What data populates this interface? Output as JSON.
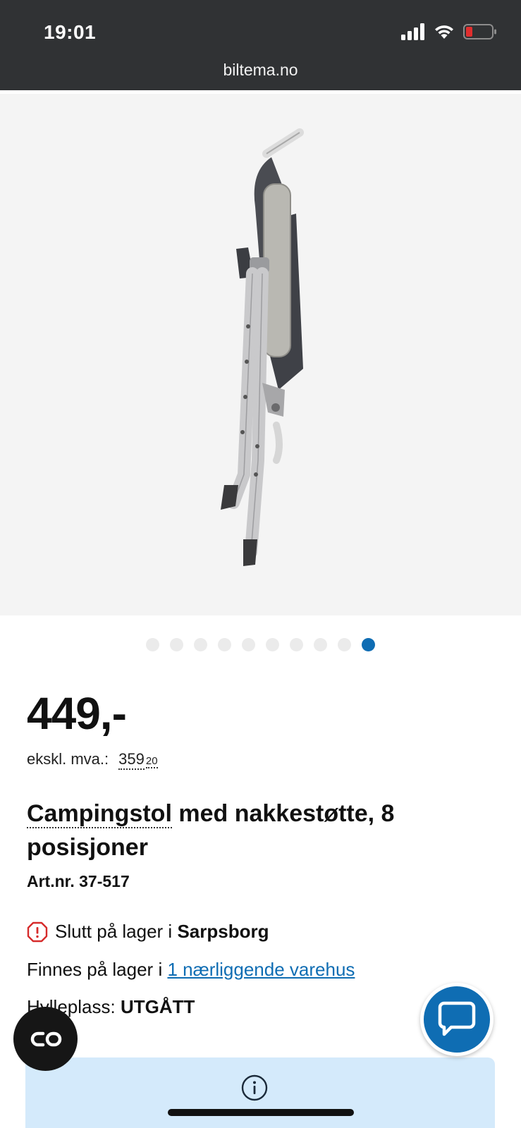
{
  "status_bar": {
    "time": "19:01",
    "url": "biltema.no"
  },
  "gallery": {
    "image_count": 10,
    "active_index": 9
  },
  "product": {
    "price": "449,-",
    "ex_vat_label": "ekskl. mva.:",
    "ex_vat_value": "359",
    "ex_vat_decimals": "20",
    "title_link": "Campingstol",
    "title_rest": " med nakkestøtte, 8 posisjoner",
    "art_nr": "Art.nr. 37-517"
  },
  "stock": {
    "status_text": "Slutt på lager i ",
    "store": "Sarpsborg",
    "nearby_prefix": "Finnes på lager i ",
    "nearby_link": "1 nærliggende varehus",
    "shelf_label": "Hylleplass: ",
    "shelf_value": "UTGÅTT"
  },
  "colors": {
    "accent": "#0f6db3",
    "status_bar": "#303234",
    "info_bg": "#d4eafb",
    "warning": "#d62b2b"
  },
  "icons": [
    "signal-icon",
    "wifi-icon",
    "battery-icon",
    "warning-icon",
    "info-icon",
    "chat-icon",
    "compare-icon"
  ]
}
